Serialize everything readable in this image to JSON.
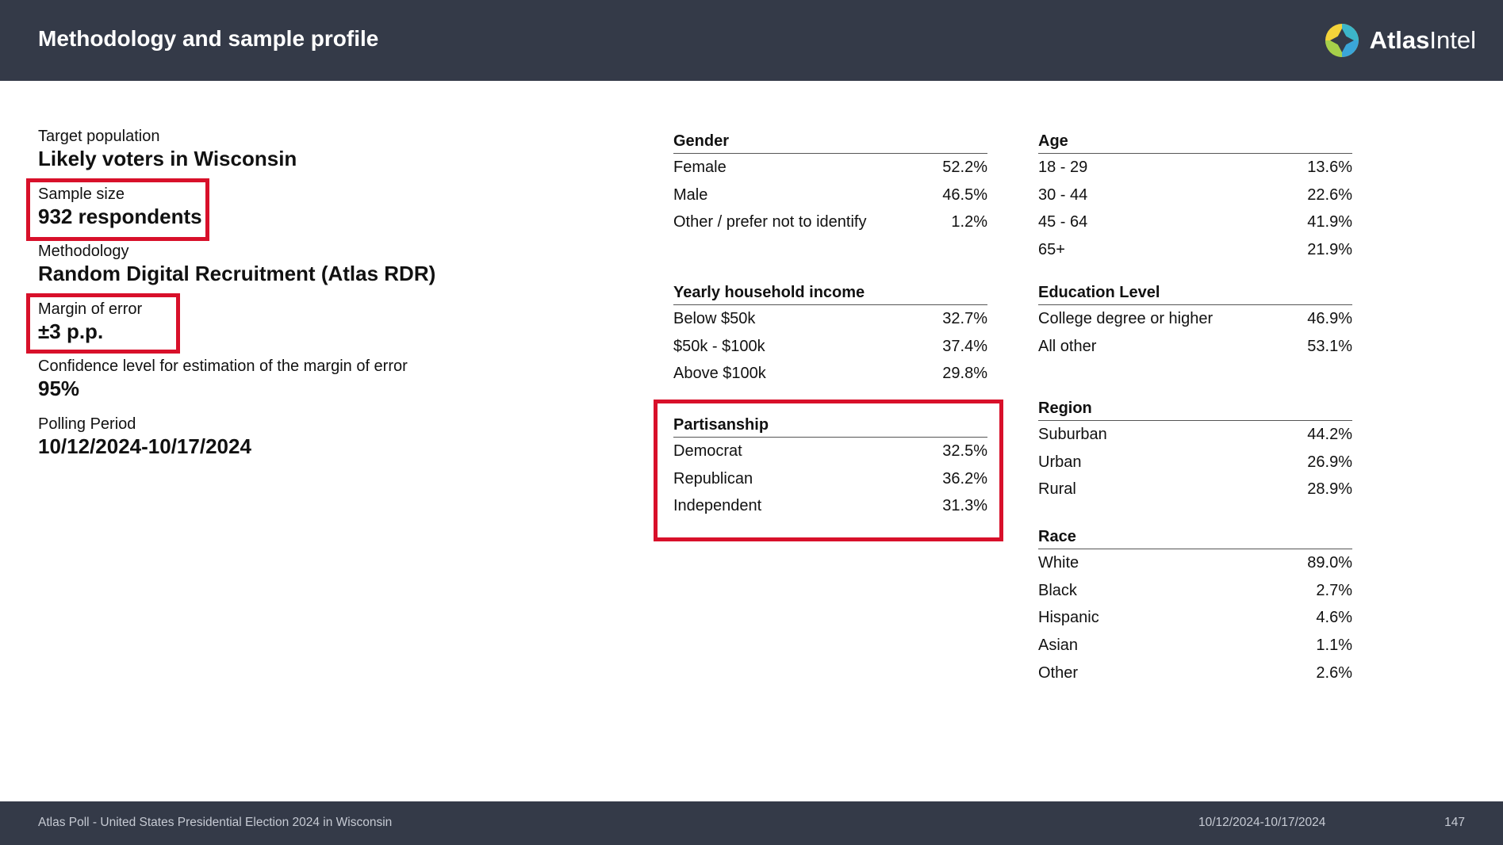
{
  "header": {
    "title": "Methodology and sample profile",
    "brand_bold": "Atlas",
    "brand_light": "Intel"
  },
  "profile": [
    {
      "label": "Target population",
      "value": "Likely voters in Wisconsin"
    },
    {
      "label": "Sample size",
      "value": "932 respondents"
    },
    {
      "label": "Methodology",
      "value": "Random Digital Recruitment  (Atlas RDR)"
    },
    {
      "label": "Margin of error",
      "value": "±3 p.p."
    },
    {
      "label": "Confidence level for estimation of the margin of error",
      "value": "95%"
    },
    {
      "label": "Polling Period",
      "value": "10/12/2024-10/17/2024"
    }
  ],
  "tables": {
    "gender": {
      "title": "Gender",
      "rows": [
        {
          "label": "Female",
          "value": "52.2%"
        },
        {
          "label": "Male",
          "value": "46.5%"
        },
        {
          "label": "Other / prefer not to identify",
          "value": "1.2%"
        }
      ]
    },
    "income": {
      "title": "Yearly household income",
      "rows": [
        {
          "label": "Below $50k",
          "value": "32.7%"
        },
        {
          "label": "$50k - $100k",
          "value": "37.4%"
        },
        {
          "label": "Above $100k",
          "value": "29.8%"
        }
      ]
    },
    "partisanship": {
      "title": "Partisanship",
      "rows": [
        {
          "label": "Democrat",
          "value": "32.5%"
        },
        {
          "label": "Republican",
          "value": "36.2%"
        },
        {
          "label": "Independent",
          "value": "31.3%"
        }
      ]
    },
    "age": {
      "title": "Age",
      "rows": [
        {
          "label": "18 - 29",
          "value": "13.6%"
        },
        {
          "label": "30 - 44",
          "value": "22.6%"
        },
        {
          "label": "45 - 64",
          "value": "41.9%"
        },
        {
          "label": "65+",
          "value": "21.9%"
        }
      ]
    },
    "education": {
      "title": "Education Level",
      "rows": [
        {
          "label": "College degree or higher",
          "value": "46.9%"
        },
        {
          "label": "All other",
          "value": "53.1%"
        }
      ]
    },
    "region": {
      "title": "Region",
      "rows": [
        {
          "label": "Suburban",
          "value": "44.2%"
        },
        {
          "label": "Urban",
          "value": "26.9%"
        },
        {
          "label": "Rural",
          "value": "28.9%"
        }
      ]
    },
    "race": {
      "title": "Race",
      "rows": [
        {
          "label": "White",
          "value": "89.0%"
        },
        {
          "label": "Black",
          "value": "2.7%"
        },
        {
          "label": "Hispanic",
          "value": "4.6%"
        },
        {
          "label": "Asian",
          "value": "1.1%"
        },
        {
          "label": "Other",
          "value": "2.6%"
        }
      ]
    }
  },
  "footer": {
    "source": "Atlas Poll - United States Presidential Election 2024 in Wisconsin",
    "period": "10/12/2024-10/17/2024",
    "page": "147"
  },
  "colors": {
    "header_bg": "#343a48",
    "highlight": "#d8102a"
  }
}
